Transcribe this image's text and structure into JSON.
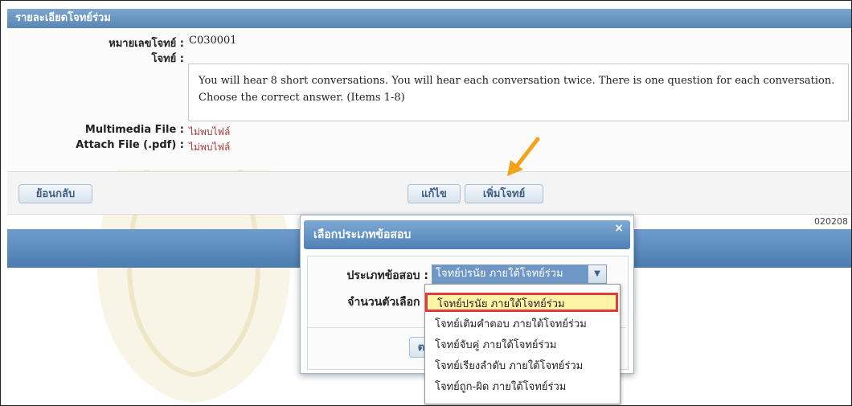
{
  "panel": {
    "title": "รายละเอียดโจทย์ร่วม"
  },
  "detail": {
    "question_no_label": "หมายเลขโจทย์ :",
    "question_no_value": "C030001",
    "question_label": "โจทย์ :",
    "question_text": "You will hear 8 short conversations.  You will hear each conversation twice.  There is one question for each conversation. Choose the correct answer. (Items 1-8)",
    "multimedia_label": "Multimedia File :",
    "multimedia_value": "ไม่พบไฟล์",
    "attach_label": "Attach File (.pdf) :",
    "attach_value": "ไม่พบไฟล์"
  },
  "toolbar": {
    "back_label": "ย้อนกลับ",
    "edit_label": "แก้ไข",
    "add_label": "เพิ่มโจทย์"
  },
  "code_partial": "020208",
  "modal": {
    "title": "เลือกประเภทข้อสอบ",
    "close": "×",
    "type_label": "ประเภทข้อสอบ :",
    "type_value": "โจทย์ปรนัย ภายใต้โจทย์ร่วม",
    "choices_label": "จำนวนตัวเลือก :",
    "button_stub": "ต"
  },
  "dropdown": {
    "options": [
      "โจทย์ปรนัย ภายใต้โจทย์ร่วม",
      "โจทย์เติมคำตอบ ภายใต้โจทย์ร่วม",
      "โจทย์จับคู่ ภายใต้โจทย์ร่วม",
      "โจทย์เรียงลำดับ ภายใต้โจทย์ร่วม",
      "โจทย์ถูก-ผิด ภายใต้โจทย์ร่วม"
    ],
    "selected_index": 0
  },
  "icons": {
    "arrow": "arrow-pointer-icon",
    "dropdown": "chevron-down-icon"
  },
  "colors": {
    "header_blue": "#5a86b4",
    "highlight_border": "#e53a3a",
    "highlight_fill": "#fff4a6",
    "arrow": "#f2a31b"
  }
}
